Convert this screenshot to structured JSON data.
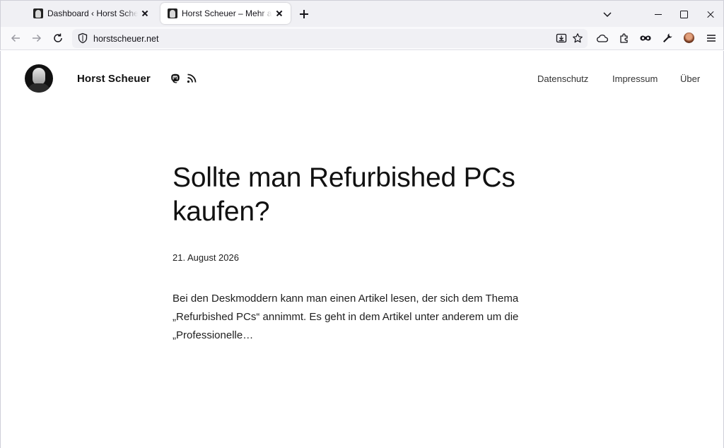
{
  "browser": {
    "tabs": [
      {
        "title": "Dashboard ‹ Horst Scheuer – WordPress",
        "active": false
      },
      {
        "title": "Horst Scheuer – Mehr als Technik",
        "active": true
      }
    ],
    "url": "horstscheuer.net"
  },
  "site": {
    "title": "Horst Scheuer",
    "menu": [
      "Datenschutz",
      "Impressum",
      "Über"
    ]
  },
  "post": {
    "title": "Sollte man Refurbished PCs kaufen?",
    "date": "21. August 2026",
    "excerpt": "Bei den Deskmoddern kann man einen Artikel lesen, der sich dem Thema „Refurbished PCs“ annimmt. Es geht in dem Artikel unter anderem um die „Professionelle…"
  }
}
